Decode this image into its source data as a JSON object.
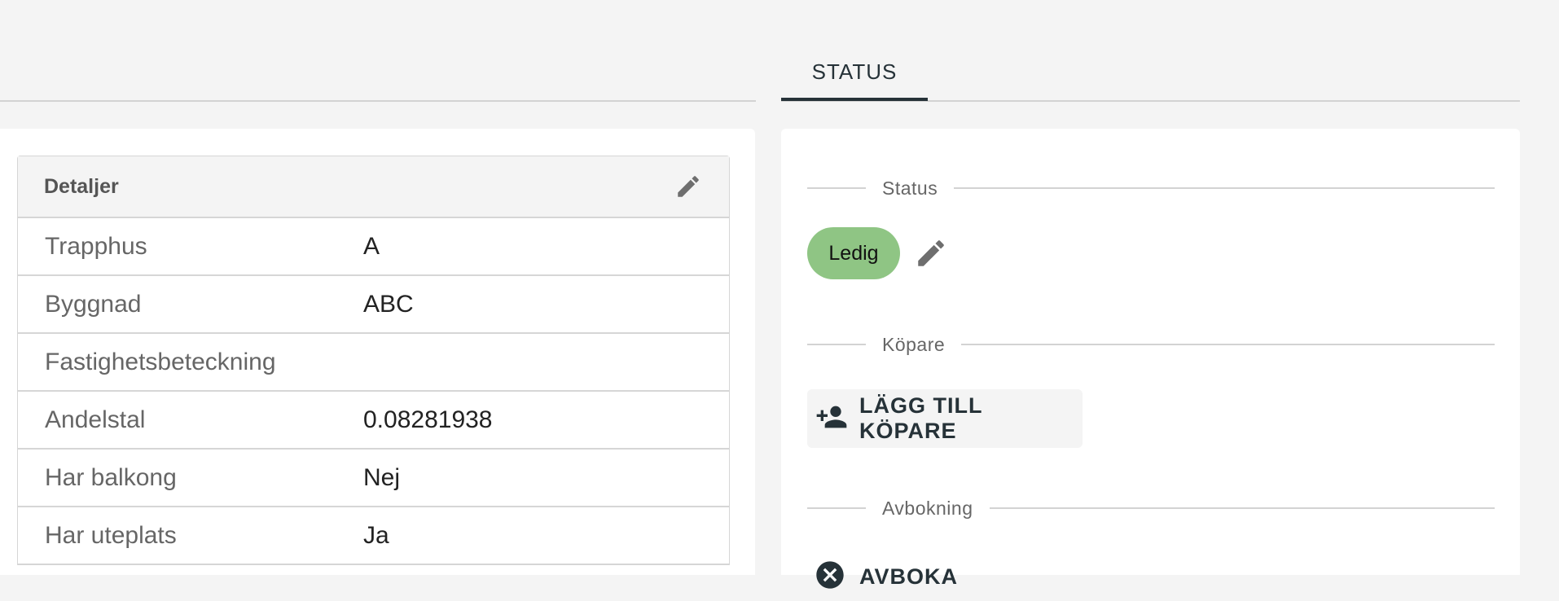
{
  "tabs": {
    "active_label": "STATUS"
  },
  "details": {
    "title": "Detaljer",
    "rows": [
      {
        "label": "Trapphus",
        "value": "A"
      },
      {
        "label": "Byggnad",
        "value": "ABC"
      },
      {
        "label": "Fastighetsbeteckning",
        "value": ""
      },
      {
        "label": "Andelstal",
        "value": "0.08281938"
      },
      {
        "label": "Har balkong",
        "value": "Nej"
      },
      {
        "label": "Har uteplats",
        "value": "Ja"
      }
    ]
  },
  "status_panel": {
    "status_section_label": "Status",
    "status_value": "Ledig",
    "status_color": "#8fc584",
    "buyer_section_label": "Köpare",
    "add_buyer_label": "LÄGG TILL KÖPARE",
    "cancellation_section_label": "Avbokning",
    "cancel_label": "AVBOKA"
  },
  "icons": {
    "edit": "pencil-icon",
    "add_person": "person-add-icon",
    "cancel": "cancel-circle-icon"
  }
}
